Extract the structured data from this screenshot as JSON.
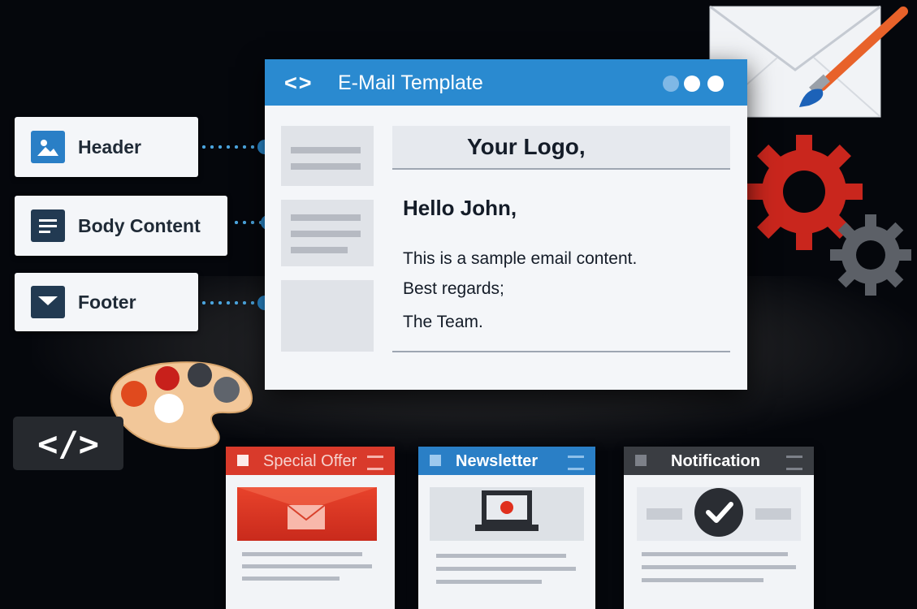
{
  "labels": {
    "header": "Header",
    "body_content": "Body Content",
    "footer": "Footer"
  },
  "window": {
    "title_icon": "<>",
    "title": "E-Mail Template",
    "logo": "Your Logo,",
    "greeting": "Hello John,",
    "body_lines": [
      "This is a sample email content.",
      "Best regards;",
      "The Team."
    ]
  },
  "code_badge": "</>",
  "cards": [
    {
      "title": "Special Offer",
      "accent": "#d93a2b"
    },
    {
      "title": "Newsletter",
      "accent": "#2a7fc6"
    },
    {
      "title": "Notification",
      "accent": "#3a3d42"
    }
  ],
  "icons": [
    "image-icon",
    "text-lines-icon",
    "envelope-icon",
    "envelope-brush-icon",
    "gears-icon",
    "palette-icon",
    "code-icon",
    "laptop-icon",
    "checkmark-icon"
  ],
  "colors": {
    "accent_blue": "#2a8ad0",
    "accent_red": "#d93a2b",
    "dark": "#141c28",
    "background": "#05070c"
  }
}
